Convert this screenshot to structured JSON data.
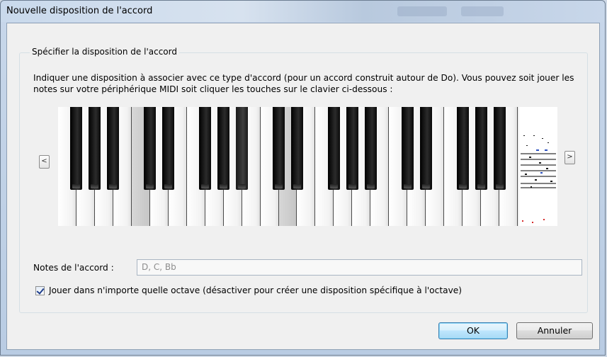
{
  "window": {
    "title": "Nouvelle disposition de l'accord"
  },
  "group": {
    "title": "Spécifier la disposition de l'accord",
    "instructions": "Indiquer une disposition à associer avec ce type d'accord (pour un accord construit autour de Do). Vous pouvez soit jouer les notes sur votre périphérique MIDI soit cliquer les touches sur le clavier ci-dessous :"
  },
  "keyboard": {
    "scroll_left_label": "<",
    "scroll_right_label": ">",
    "pressed_keys": [
      "D",
      "C",
      "Bb"
    ]
  },
  "notes": {
    "label": "Notes de l'accord :",
    "value": "D, C, Bb"
  },
  "octave_option": {
    "checked": true,
    "label": "Jouer dans n'importe quelle octave (désactiver pour créer une disposition spécifique à l'octave)"
  },
  "buttons": {
    "ok_label": "OK",
    "cancel_label": "Annuler"
  },
  "colors": {
    "ok_border": "#3c7fb1",
    "check_mark": "#1f3e8c"
  }
}
